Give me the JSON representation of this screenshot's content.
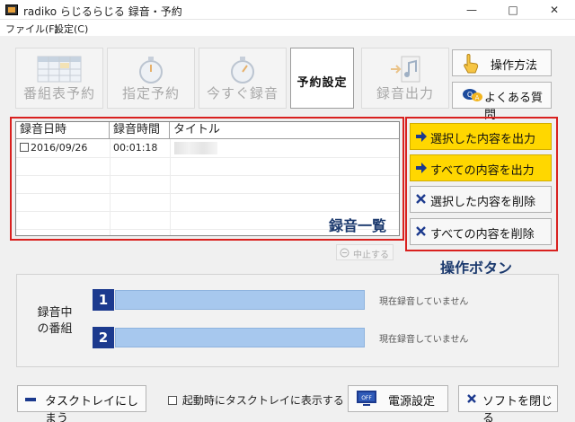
{
  "window": {
    "title": "radiko らじるらじる 録音・予約",
    "minimize": "—",
    "maximize": "□",
    "close": "✕"
  },
  "menu": {
    "file": "ファイル(F)",
    "settings": "設定(C)"
  },
  "toolbar": {
    "schedule_reserve": "番組表予約",
    "specified_reserve": "指定予約",
    "record_now": "今すぐ録音",
    "reserve_settings": "予約設定",
    "record_output": "録音出力"
  },
  "side": {
    "how_to": "操作方法",
    "faq": "よくある質問"
  },
  "recordings": {
    "columns": [
      "録音日時",
      "録音時間",
      "タイトル"
    ],
    "rows": [
      {
        "date": "2016/09/26",
        "duration": "00:01:18"
      }
    ]
  },
  "ops": {
    "export_selected": "選択した内容を出力",
    "export_all": "すべての内容を出力",
    "delete_selected": "選択した内容を削除",
    "delete_all": "すべての内容を削除"
  },
  "callouts": {
    "list": "録音一覧",
    "ops": "操作ボタン"
  },
  "stop": {
    "label": "中止する"
  },
  "recording_now": {
    "label": "録音中の番組",
    "slots": [
      {
        "num": "1",
        "status": "現在録音していません"
      },
      {
        "num": "2",
        "status": "現在録音していません"
      }
    ]
  },
  "bottom": {
    "tray": "タスクトレイにしまう",
    "tray_on_start": "起動時にタスクトレイに表示する",
    "power": "電源設定",
    "close_app": "ソフトを閉じる"
  },
  "colors": {
    "accent_yellow": "#ffd700",
    "callout_red": "#d9211f",
    "navy": "#1c3a8e",
    "bar_blue": "#a7c8ee"
  }
}
